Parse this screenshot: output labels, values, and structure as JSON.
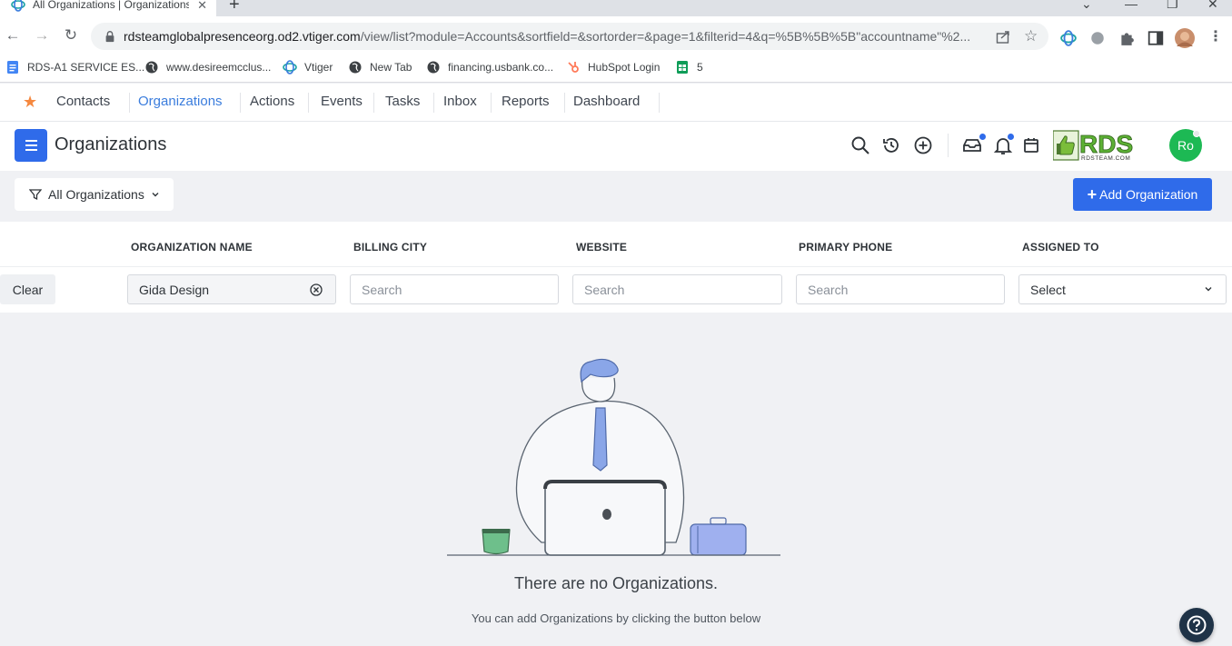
{
  "browser": {
    "tab_title": "All Organizations | Organizations",
    "url_host": "rdsteamglobalpresenceorg.od2.vtiger.com",
    "url_path": "/view/list?module=Accounts&sortfield=&sortorder=&page=1&filterid=4&q=%5B%5B%5B\"accountname\"%2...",
    "bookmarks": [
      {
        "label": "RDS-A1 SERVICE ES...",
        "icon": "docs-icon"
      },
      {
        "label": "www.desireemcclus...",
        "icon": "globe-icon"
      },
      {
        "label": "Vtiger",
        "icon": "vtiger-icon"
      },
      {
        "label": "New Tab",
        "icon": "globe-icon"
      },
      {
        "label": "financing.usbank.co...",
        "icon": "globe-icon"
      },
      {
        "label": "HubSpot Login",
        "icon": "hubspot-icon"
      },
      {
        "label": "5",
        "icon": "sheets-icon"
      }
    ]
  },
  "nav": {
    "items": [
      {
        "label": "Contacts"
      },
      {
        "label": "Organizations"
      },
      {
        "label": "Actions"
      },
      {
        "label": "Events"
      },
      {
        "label": "Tasks"
      },
      {
        "label": "Inbox"
      },
      {
        "label": "Reports"
      },
      {
        "label": "Dashboard"
      }
    ],
    "active": "Organizations"
  },
  "header": {
    "title": "Organizations",
    "logo_text": "RDS",
    "logo_subtext": "RDSTEAM.COM",
    "avatar_initials": "Ro"
  },
  "filter": {
    "label": "All Organizations",
    "add_button": "Add Organization"
  },
  "table": {
    "columns": [
      "ORGANIZATION NAME",
      "BILLING CITY",
      "WEBSITE",
      "PRIMARY PHONE",
      "ASSIGNED TO"
    ],
    "clear_label": "Clear",
    "search": {
      "organization_name_value": "Gida Design",
      "billing_city_placeholder": "Search",
      "website_placeholder": "Search",
      "primary_phone_placeholder": "Search",
      "assigned_to_value": "Select"
    }
  },
  "empty": {
    "title": "There are no Organizations.",
    "subtitle": "You can add Organizations by clicking the button below"
  },
  "colors": {
    "accent": "#2f6bea",
    "nav_active": "#3b7ddd",
    "star": "#f5883f",
    "avatar": "#1db954"
  }
}
